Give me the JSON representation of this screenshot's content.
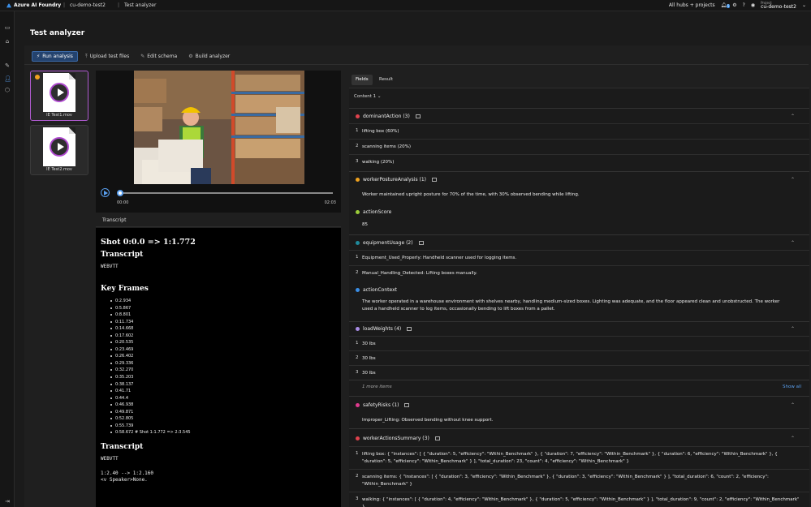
{
  "topbar": {
    "brand": "Azure AI Foundry",
    "breadcrumb_1": "cu-demo-test2",
    "breadcrumb_2": "Test analyzer",
    "hubs": "All hubs + projects",
    "notification_count": "5",
    "project_label": "Project",
    "project_value": "cu-demo-test2"
  },
  "page": {
    "title": "Test analyzer"
  },
  "toolbar": {
    "run": "Run analysis",
    "upload": "Upload test files",
    "edit": "Edit schema",
    "build": "Build analyzer"
  },
  "files": [
    {
      "name": "IE Test1.mov"
    },
    {
      "name": "IE Test2.mov"
    }
  ],
  "player": {
    "time_start": "00:00",
    "time_end": "02:03"
  },
  "transcript": {
    "tab_label": "Transcript",
    "shot": "Shot 0:0.0 => 1:1.772",
    "heading1": "Transcript",
    "webvtt1": "WEBVTT",
    "keyframes_heading": "Key Frames",
    "keyframes": [
      "0:2.934",
      "0:5.867",
      "0:8.801",
      "0:11.734",
      "0:14.668",
      "0:17.602",
      "0:20.535",
      "0:23.469",
      "0:26.402",
      "0:29.336",
      "0:32.270",
      "0:35.203",
      "0:38.137",
      "0:41.71",
      "0:44.4",
      "0:46.938",
      "0:49.871",
      "0:52.805",
      "0:55.739",
      "0:58.672  # Shot 1:1.772 => 2:3.545"
    ],
    "heading2": "Transcript",
    "webvtt2": "WEBVTT",
    "cue": "1:2.40 --> 1:2.160\n<v Speaker>None."
  },
  "tabs": {
    "fields": "Fields",
    "result": "Result"
  },
  "content_selector": "Content 1 ⌄",
  "fields": {
    "dominantAction": {
      "label": "dominantAction (3)",
      "items": [
        "lifting box (60%)",
        "scanning items (20%)",
        "walking (20%)"
      ]
    },
    "workerPostureAnalysis": {
      "label": "workerPostureAnalysis (1)",
      "text": "Worker maintained upright posture for 70% of the time, with 30% observed bending while lifting."
    },
    "actionScore": {
      "label": "actionScore",
      "value": "85"
    },
    "equipmentUsage": {
      "label": "equipmentUsage (2)",
      "items": [
        "Equipment_Used_Properly: Handheld scanner used for logging items.",
        "Manual_Handling_Detected: Lifting boxes manually."
      ]
    },
    "actionContext": {
      "label": "actionContext",
      "text": "The worker operated in a warehouse environment with shelves nearby, handling medium-sized boxes. Lighting was adequate, and the floor appeared clean and unobstructed. The worker used a handheld scanner to log items, occasionally bending to lift boxes from a pallet."
    },
    "loadWeights": {
      "label": "loadWeights (4)",
      "items": [
        "30 lbs",
        "30 lbs",
        "30 lbs"
      ],
      "more": "1 more items",
      "show_all": "Show all"
    },
    "safetyRisks": {
      "label": "safetyRisks (1)",
      "text": "Improper_Lifting: Observed bending without knee support."
    },
    "workerActionsSummary": {
      "label": "workerActionsSummary (3)",
      "items": [
        "lifting box: { \"instances\": [ { \"duration\": 5, \"efficiency\": \"Within_Benchmark\" }, { \"duration\": 7, \"efficiency\": \"Within_Benchmark\" }, { \"duration\": 6, \"efficiency\": \"Within_Benchmark\" }, { \"duration\": 5, \"efficiency\": \"Within_Benchmark\" } ], \"total_duration\": 23, \"count\": 4, \"efficiency\": \"Within_Benchmark\" }",
        "scanning items: { \"instances\": [ { \"duration\": 3, \"efficiency\": \"Within_Benchmark\" }, { \"duration\": 3, \"efficiency\": \"Within_Benchmark\" } ], \"total_duration\": 6, \"count\": 2, \"efficiency\": \"Within_Benchmark\" }",
        "walking: { \"instances\": [ { \"duration\": 4, \"efficiency\": \"Within_Benchmark\" }, { \"duration\": 5, \"efficiency\": \"Within_Benchmark\" } ], \"total_duration\": 9, \"count\": 2, \"efficiency\": \"Within_Benchmark\" }"
      ]
    }
  },
  "colors": {
    "dominantAction": "#e0424d",
    "workerPostureAnalysis": "#f0a21e",
    "actionScore": "#9bcc3a",
    "equipmentUsage": "#1f8a9c",
    "actionContext": "#3a8ee6",
    "loadWeights": "#a98ce6",
    "safetyRisks": "#e03a8e",
    "workerActionsSummary": "#e0424d"
  }
}
